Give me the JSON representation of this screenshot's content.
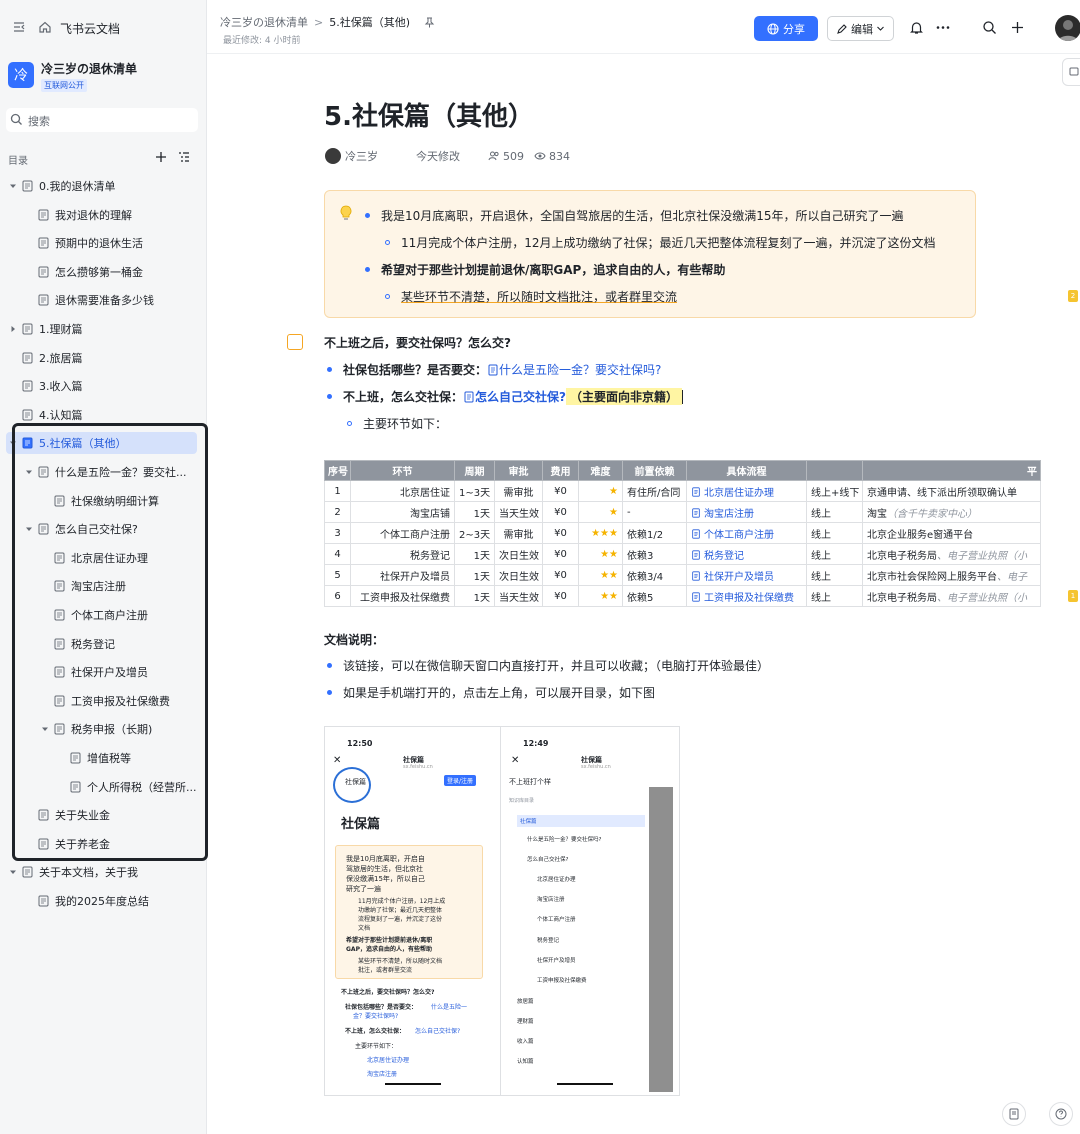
{
  "app": {
    "name": "飞书云文档"
  },
  "space": {
    "logo_char": "冷",
    "name": "冷三岁の退休清单",
    "badge": "互联网公开"
  },
  "search": {
    "placeholder": "搜索"
  },
  "toc": {
    "label": "目录"
  },
  "tree": [
    {
      "label": "0.我的退休清单",
      "level": 0,
      "arrow": "down"
    },
    {
      "label": "我对退休的理解",
      "level": 1,
      "arrow": ""
    },
    {
      "label": "预期中的退休生活",
      "level": 1,
      "arrow": ""
    },
    {
      "label": "怎么攒够第一桶金",
      "level": 1,
      "arrow": ""
    },
    {
      "label": "退休需要准备多少钱",
      "level": 1,
      "arrow": ""
    },
    {
      "label": "1.理财篇",
      "level": 0,
      "arrow": "right"
    },
    {
      "label": "2.旅居篇",
      "level": 0,
      "arrow": ""
    },
    {
      "label": "3.收入篇",
      "level": 0,
      "arrow": ""
    },
    {
      "label": "4.认知篇",
      "level": 0,
      "arrow": ""
    },
    {
      "label": "5.社保篇（其他）",
      "level": 0,
      "arrow": "down",
      "active": true
    },
    {
      "label": "什么是五险一金？要交社...",
      "level": 1,
      "arrow": "down"
    },
    {
      "label": "社保缴纳明细计算",
      "level": 2,
      "arrow": ""
    },
    {
      "label": "怎么自己交社保?",
      "level": 1,
      "arrow": "down"
    },
    {
      "label": "北京居住证办理",
      "level": 2,
      "arrow": ""
    },
    {
      "label": "淘宝店注册",
      "level": 2,
      "arrow": ""
    },
    {
      "label": "个体工商户注册",
      "level": 2,
      "arrow": ""
    },
    {
      "label": "税务登记",
      "level": 2,
      "arrow": ""
    },
    {
      "label": "社保开户及增员",
      "level": 2,
      "arrow": ""
    },
    {
      "label": "工资申报及社保缴费",
      "level": 2,
      "arrow": ""
    },
    {
      "label": "税务申报（长期)",
      "level": 2,
      "arrow": "down"
    },
    {
      "label": "增值税等",
      "level": 3,
      "arrow": ""
    },
    {
      "label": "个人所得税（经营所...",
      "level": 3,
      "arrow": ""
    },
    {
      "label": "关于失业金",
      "level": 1,
      "arrow": ""
    },
    {
      "label": "关于养老金",
      "level": 1,
      "arrow": ""
    },
    {
      "label": "关于本文档，关于我",
      "level": 0,
      "arrow": "down"
    },
    {
      "label": "我的2025年度总结",
      "level": 1,
      "arrow": ""
    }
  ],
  "header": {
    "breadcrumb_root": "冷三岁の退休清单",
    "breadcrumb_current": "5.社保篇（其他)",
    "last_modified": "最近修改: 4 小时前",
    "share_label": "分享",
    "edit_label": "编辑"
  },
  "doc": {
    "title": "5.社保篇（其他）",
    "author": "冷三岁",
    "modified": "今天修改",
    "readers": "509",
    "views": "834",
    "callout": {
      "line1": "我是10月底离职，开启退休，全国自驾旅居的生活，但北京社保没缴满15年，所以自己研究了一遍",
      "line2": "11月完成个体户注册，12月上成功缴纳了社保；最近几天把整体流程复刻了一遍，并沉淀了这份文档",
      "line3": "希望对于那些计划提前退休/离职GAP，追求自由的人，有些帮助",
      "line4": "某些环节不清楚，所以随时文档批注，或者群里交流"
    },
    "q_heading": "不上班之后，要交社保吗？怎么交?",
    "b1_label": "社保包括哪些？是否要交：",
    "b1_link": "什么是五险一金？要交社保吗?",
    "b2_label": "不上班，怎么交社保：",
    "b2_link": "怎么自己交社保?",
    "b2_highlight": "（主要面向非京籍）",
    "b2_sub": "主要环节如下：",
    "table": {
      "headers": [
        "序号",
        "环节",
        "周期",
        "审批",
        "费用",
        "难度",
        "前置依赖",
        "具体流程",
        "",
        "平"
      ],
      "rows": [
        [
          "1",
          "北京居住证",
          "1~3天",
          "需审批",
          "¥0",
          "★",
          "有住所/合同",
          "北京居住证办理",
          "线上+线下",
          "京通申请、线下派出所领取确认单",
          ""
        ],
        [
          "2",
          "淘宝店铺",
          "1天",
          "当天生效",
          "¥0",
          "★",
          "-",
          "淘宝店注册",
          "线上",
          "淘宝",
          "（含千牛卖家中心）"
        ],
        [
          "3",
          "个体工商户注册",
          "2~3天",
          "需审批",
          "¥0",
          "★★★",
          "依赖1/2",
          "个体工商户注册",
          "线上",
          "北京企业服务e窗通平台",
          ""
        ],
        [
          "4",
          "税务登记",
          "1天",
          "次日生效",
          "¥0",
          "★★",
          "依赖3",
          "税务登记",
          "线上",
          "北京电子税务局",
          "、电子营业执照（小"
        ],
        [
          "5",
          "社保开户及增员",
          "1天",
          "次日生效",
          "¥0",
          "★★",
          "依赖3/4",
          "社保开户及增员",
          "线上",
          "北京市社会保险网上服务平台",
          "、电子"
        ],
        [
          "6",
          "工资申报及社保缴费",
          "1天",
          "当天生效",
          "¥0",
          "★★",
          "依赖5",
          "工资申报及社保缴费",
          "线上",
          "北京电子税务局",
          "、电子营业执照（小"
        ]
      ]
    },
    "notes_heading": "文档说明：",
    "note1": "该链接，可以在微信聊天窗口内直接打开，并且可以收藏；（电脑打开体验最佳）",
    "note2": "如果是手机端打开的，点击左上角，可以展开目录，如下图"
  },
  "phone1": {
    "time": "12:50",
    "title": "社保篇",
    "url": "sx.feishu.cn",
    "tab": "社保篇",
    "button": "登录/注册",
    "heading": "社保篇",
    "c1": "我是10月底离职，开启自",
    "c2": "驾旅居的生活，但北京社",
    "c3": "保没缴满15年，所以自己",
    "c4": "研究了一遍",
    "c5": "11月完成个体户注册，12月上成",
    "c6": "功缴纳了社保；最近几天把整体",
    "c7": "流程复刻了一遍，并沉淀了这份",
    "c8": "文档",
    "c9": "希望对于那些计划提前退休/离职",
    "c10": "GAP，追求自由的人，有些帮助",
    "c11": "某些环节不清楚，所以随时文档",
    "c12": "批注，或者群里交流",
    "q": "不上班之后，要交社保吗？怎么交?",
    "b1": "社保包括哪些？是否要交：",
    "b1l": "什么是五险一",
    "b1l2": "金？要交社保吗?",
    "b2": "不上班，怎么交社保：",
    "b2l": "怎么自己交社保?",
    "sub": "主要环节如下：",
    "l1": "北京居住证办理",
    "l2": "淘宝店注册"
  },
  "phone2": {
    "time": "12:49",
    "title": "社保篇",
    "url": "sx.feishu.cn",
    "header": "不上班打个样",
    "section": "知识库目录",
    "items": [
      "社保篇",
      "什么是五险一金？要交社保吗?",
      "怎么自己交社保?",
      "北京居住证办理",
      "淘宝店注册",
      "个体工商户注册",
      "税务登记",
      "社保开户及增员",
      "工资申报及社保缴费",
      "旅居篇",
      "理财篇",
      "收入篇",
      "认知篇"
    ]
  },
  "side_comments": [
    "2",
    "1"
  ]
}
